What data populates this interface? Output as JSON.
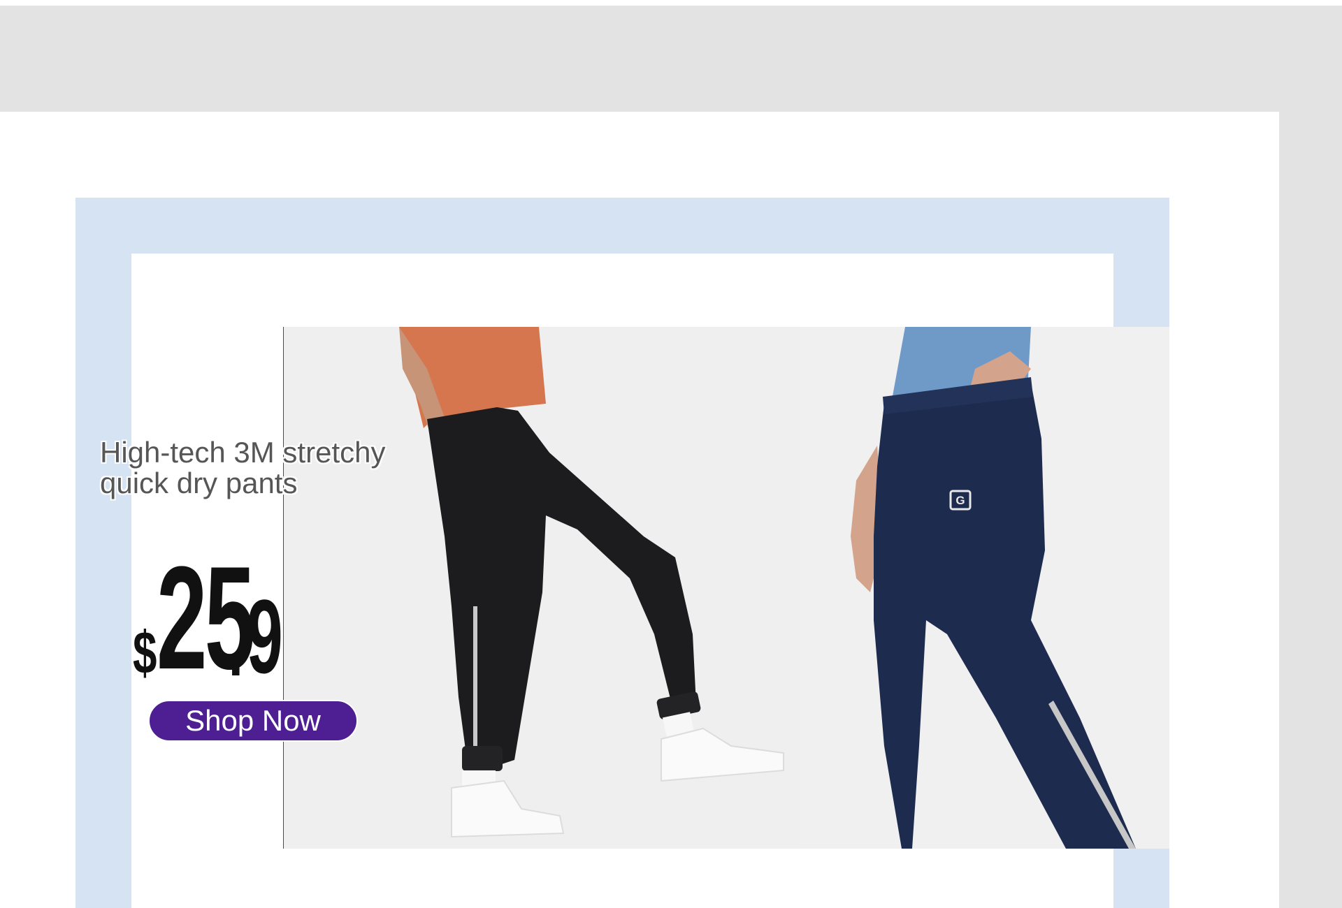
{
  "banner": {
    "headline_line1": "High-tech 3M stretchy",
    "headline_line2": "quick dry pants",
    "price": {
      "currency": "$",
      "integer": "25",
      "separator": ".",
      "decimal": "9"
    },
    "cta_label": "Shop Now"
  },
  "colors": {
    "top_band": "#e3e3e3",
    "frame": "#d6e3f2",
    "cta": "#4e1e93",
    "price": "#111111",
    "headline": "#565656"
  }
}
